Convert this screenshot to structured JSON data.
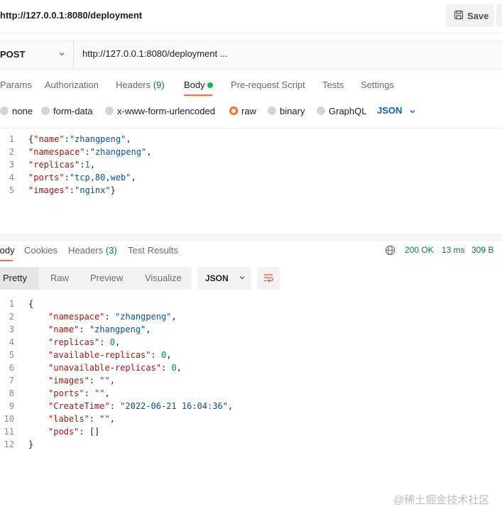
{
  "window": {
    "title": "http://127.0.0.1:8080/deployment",
    "save_label": "Save"
  },
  "request": {
    "method": "POST",
    "url": "http://127.0.0.1:8080/deployment ...",
    "tabs": [
      {
        "label": "Params"
      },
      {
        "label": "Authorization"
      },
      {
        "label": "Headers",
        "count": "(9)"
      },
      {
        "label": "Body"
      },
      {
        "label": "Pre-request Script"
      },
      {
        "label": "Tests"
      },
      {
        "label": "Settings"
      }
    ],
    "body_modes": [
      "none",
      "form-data",
      "x-www-form-urlencoded",
      "raw",
      "binary",
      "GraphQL"
    ],
    "body_mode_selected": "raw",
    "format": "JSON",
    "line_numbers": [
      "1",
      "2",
      "3",
      "4",
      "5"
    ],
    "body_lines": [
      {
        "open": "{",
        "key": "\"name\"",
        "colon": ":",
        "val": "\"zhangpeng\"",
        "end": ","
      },
      {
        "key": "\"namespace\"",
        "colon": ":",
        "val": "\"zhangpeng\"",
        "end": ","
      },
      {
        "key": "\"replicas\"",
        "colon": ":",
        "val": "1",
        "end": ","
      },
      {
        "key": "\"ports\"",
        "colon": ":",
        "val": "\"tcp,80,web\"",
        "end": ","
      },
      {
        "key": "\"images\"",
        "colon": ":",
        "val": "\"nginx\"",
        "end": "}"
      }
    ]
  },
  "response": {
    "tabs": [
      {
        "label": "Body"
      },
      {
        "label": "Cookies"
      },
      {
        "label": "Headers",
        "count": "(3)"
      },
      {
        "label": "Test Results"
      }
    ],
    "status": "200 OK",
    "time": "13 ms",
    "size": "309 B",
    "views": [
      "Pretty",
      "Raw",
      "Preview",
      "Visualize"
    ],
    "format": "JSON",
    "line_numbers": [
      "1",
      "2",
      "3",
      "4",
      "5",
      "6",
      "7",
      "8",
      "9",
      "10",
      "11",
      "12"
    ],
    "lines": [
      {
        "text": "{"
      },
      {
        "key": "\"namespace\"",
        "sep": ": ",
        "val": "\"zhangpeng\"",
        "end": ","
      },
      {
        "key": "\"name\"",
        "sep": ": ",
        "val": "\"zhangpeng\"",
        "end": ","
      },
      {
        "key": "\"replicas\"",
        "sep": ": ",
        "val": "0",
        "end": ","
      },
      {
        "key": "\"available-replicas\"",
        "sep": ": ",
        "val": "0",
        "end": ","
      },
      {
        "key": "\"unavailable-replicas\"",
        "sep": ": ",
        "val": "0",
        "end": ","
      },
      {
        "key": "\"images\"",
        "sep": ": ",
        "val": "\"\"",
        "end": ","
      },
      {
        "key": "\"ports\"",
        "sep": ": ",
        "val": "\"\"",
        "end": ","
      },
      {
        "key": "\"CreateTime\"",
        "sep": ": ",
        "val": "\"2022-06-21 16:04:36\"",
        "end": ","
      },
      {
        "key": "\"labels\"",
        "sep": ": ",
        "val": "\"\"",
        "end": ","
      },
      {
        "key": "\"pods\"",
        "sep": ": ",
        "val": "[]",
        "end": ""
      },
      {
        "text": "}"
      }
    ]
  },
  "watermark": "@稀土掘金技术社区",
  "colors": {
    "accent": "#ff6c37",
    "status_ok": "#0a7a3e",
    "json_key": "#a31515",
    "json_string": "#0451a5",
    "json_number": "#098658"
  }
}
